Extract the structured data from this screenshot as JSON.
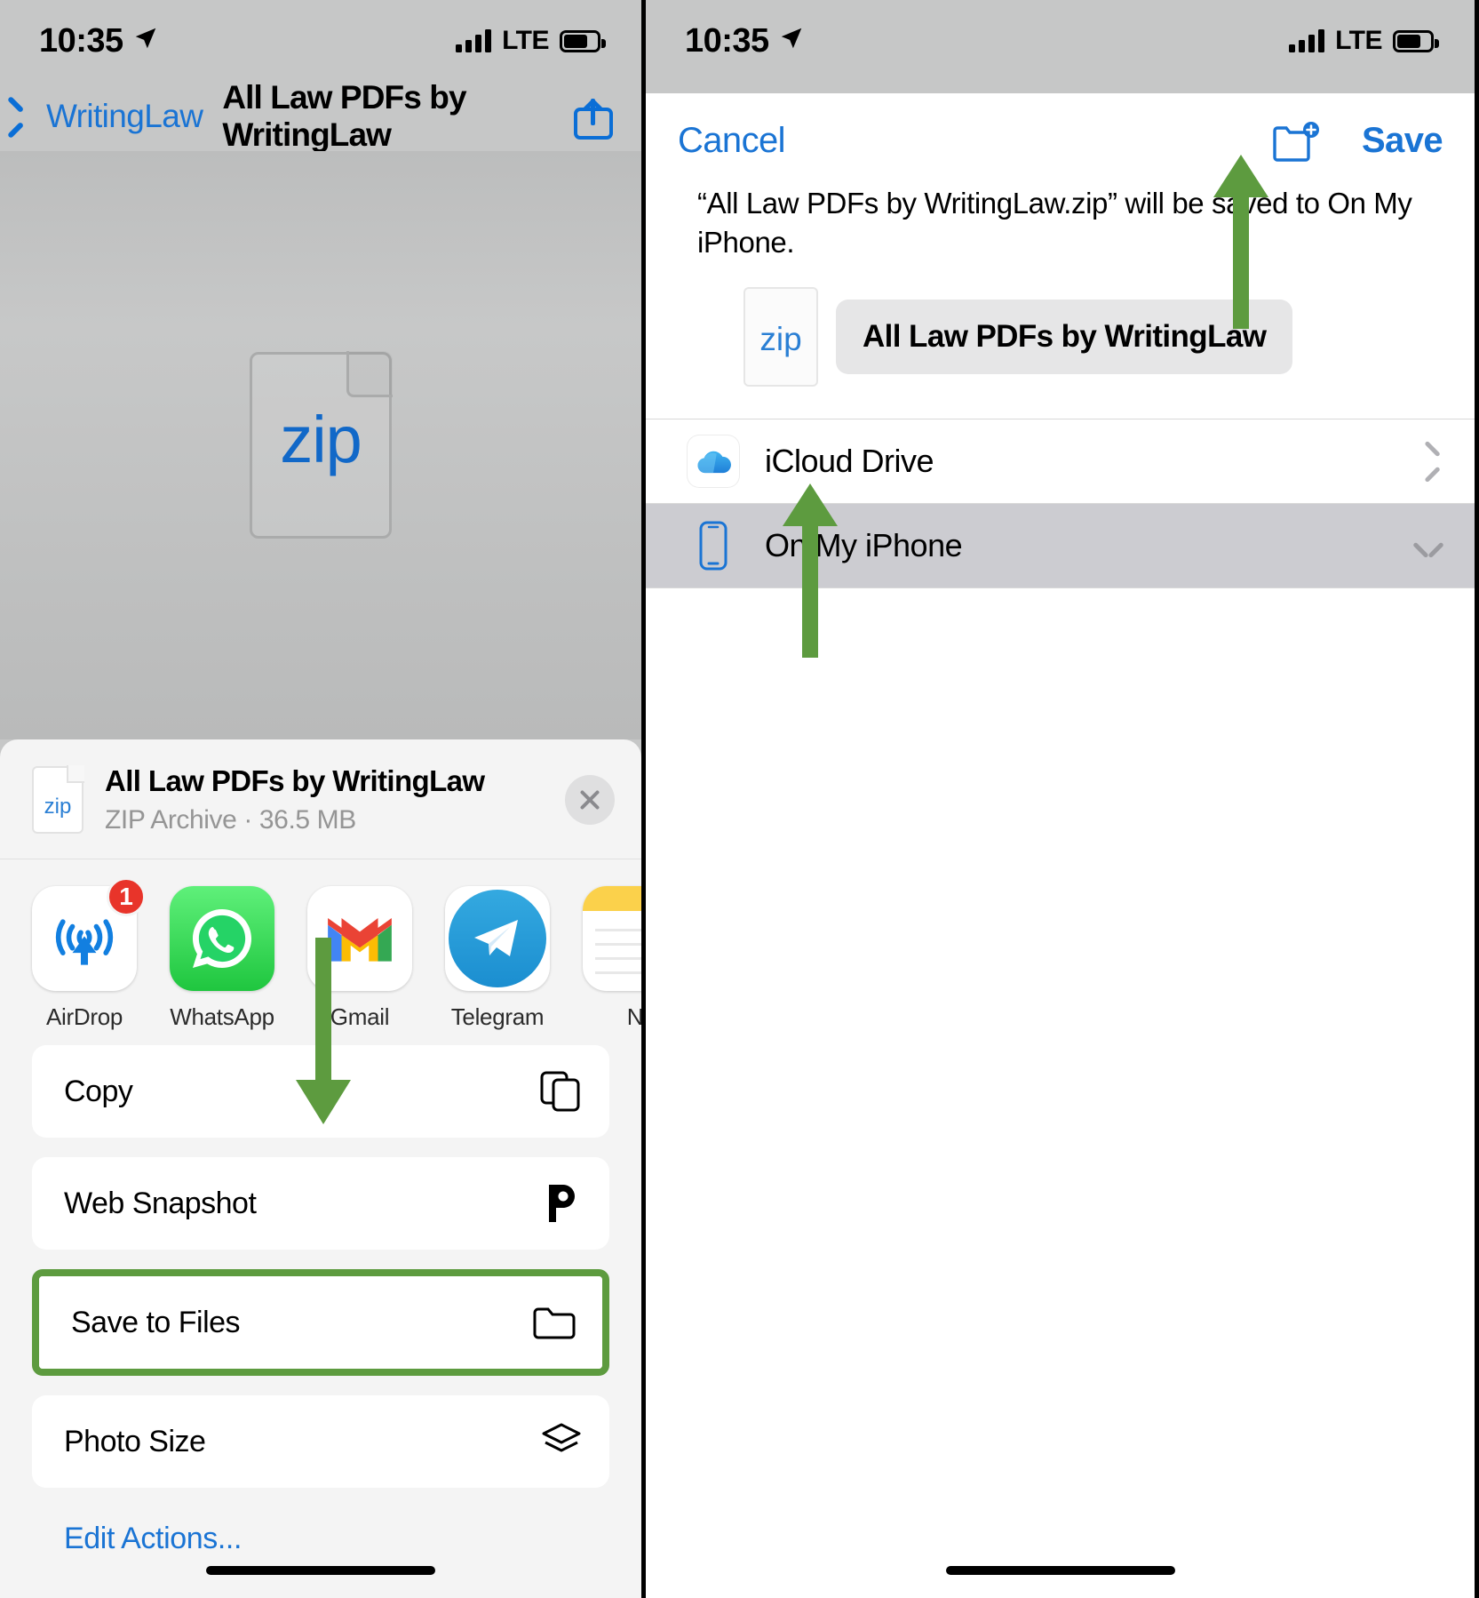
{
  "status_bar": {
    "time": "10:35",
    "location_icon": "location-arrow-icon",
    "carrier": "LTE"
  },
  "left_panel": {
    "nav": {
      "back_label": "WritingLaw",
      "title": "All Law PDFs by WritingLaw",
      "share_icon": "share-icon"
    },
    "document_preview": {
      "badge": "zip"
    },
    "share_sheet": {
      "file": {
        "icon_badge": "zip",
        "title": "All Law PDFs by WritingLaw",
        "subtitle": "ZIP Archive · 36.5 MB"
      },
      "close_label": "Close",
      "apps": [
        {
          "label": "AirDrop",
          "icon": "airdrop-icon",
          "badge": "1"
        },
        {
          "label": "WhatsApp",
          "icon": "whatsapp-icon",
          "badge": ""
        },
        {
          "label": "Gmail",
          "icon": "gmail-icon",
          "badge": ""
        },
        {
          "label": "Telegram",
          "icon": "telegram-icon",
          "badge": ""
        },
        {
          "label": "N",
          "icon": "notes-icon",
          "badge": ""
        }
      ],
      "actions": [
        {
          "label": "Copy",
          "icon": "copy-icon",
          "highlighted": false
        },
        {
          "label": "Web Snapshot",
          "icon": "pocket-p-icon",
          "highlighted": false
        },
        {
          "label": "Save to Files",
          "icon": "folder-icon",
          "highlighted": true
        },
        {
          "label": "Photo Size",
          "icon": "layers-icon",
          "highlighted": false
        }
      ],
      "edit_actions_label": "Edit Actions..."
    }
  },
  "right_panel": {
    "save_dialog": {
      "cancel_label": "Cancel",
      "new_folder_icon": "new-folder-icon",
      "save_label": "Save",
      "description": "“All Law PDFs by WritingLaw.zip” will be saved to On My iPhone.",
      "file_icon_badge": "zip",
      "filename_value": "All Law PDFs by WritingLaw",
      "locations": [
        {
          "label": "iCloud Drive",
          "icon": "icloud-icon",
          "accessory": "chevron-right-icon",
          "selected": false
        },
        {
          "label": "On My iPhone",
          "icon": "iphone-icon",
          "accessory": "chevron-down-icon",
          "selected": true
        }
      ]
    }
  },
  "annotations": {
    "color": "#5d9b3f",
    "arrows": [
      {
        "name": "arrow-to-save-to-files",
        "direction": "down"
      },
      {
        "name": "arrow-to-save-button",
        "direction": "up"
      },
      {
        "name": "arrow-to-on-my-iphone",
        "direction": "up"
      }
    ],
    "highlight_box_target": "Save to Files"
  }
}
